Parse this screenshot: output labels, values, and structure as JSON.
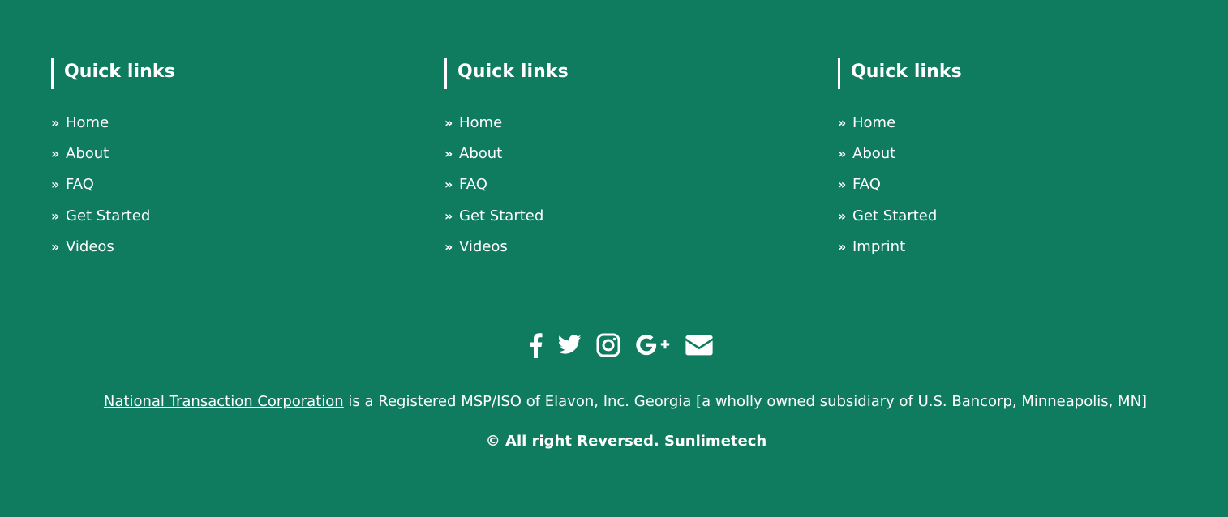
{
  "colors": {
    "background": "#0f7b5f",
    "text": "#ffffff"
  },
  "columns": [
    {
      "heading": "Quick links",
      "links": [
        {
          "icon": "chevron-double-right-icon",
          "label": "Home"
        },
        {
          "icon": "chevron-double-right-icon",
          "label": "About"
        },
        {
          "icon": "chevron-double-right-icon",
          "label": "FAQ"
        },
        {
          "icon": "chevron-double-right-icon",
          "label": "Get Started"
        },
        {
          "icon": "chevron-double-right-icon",
          "label": "Videos"
        }
      ]
    },
    {
      "heading": "Quick links",
      "links": [
        {
          "icon": "chevron-double-right-icon",
          "label": "Home"
        },
        {
          "icon": "chevron-double-right-icon",
          "label": "About"
        },
        {
          "icon": "chevron-double-right-icon",
          "label": "FAQ"
        },
        {
          "icon": "chevron-double-right-icon",
          "label": "Get Started"
        },
        {
          "icon": "chevron-double-right-icon",
          "label": "Videos"
        }
      ]
    },
    {
      "heading": "Quick links",
      "links": [
        {
          "icon": "chevron-double-right-icon",
          "label": "Home"
        },
        {
          "icon": "chevron-double-right-icon",
          "label": "About"
        },
        {
          "icon": "chevron-double-right-icon",
          "label": "FAQ"
        },
        {
          "icon": "chevron-double-right-icon",
          "label": "Get Started"
        },
        {
          "icon": "chevron-double-right-icon",
          "label": "Imprint"
        }
      ]
    }
  ],
  "social_icons": [
    "facebook-icon",
    "twitter-icon",
    "instagram-icon",
    "google-plus-icon",
    "email-icon"
  ],
  "disclaimer": {
    "link_text": "National Transaction Corporation",
    "text": " is a Registered MSP/ISO of Elavon, Inc. Georgia [a wholly owned subsidiary of U.S. Bancorp, Minneapolis, MN]"
  },
  "copyright": "© All right Reversed.  Sunlimetech"
}
